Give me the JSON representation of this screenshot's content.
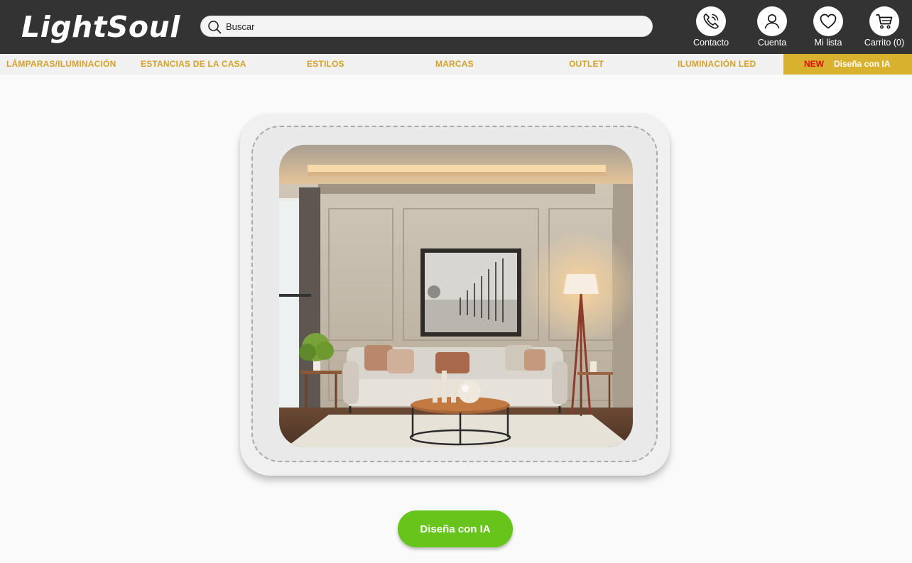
{
  "brand": {
    "logo_text": "LightSoul"
  },
  "search": {
    "placeholder": "Buscar"
  },
  "header_actions": {
    "contact": {
      "label": "Contacto",
      "icon": "phone-icon"
    },
    "account": {
      "label": "Cuenta",
      "icon": "user-icon"
    },
    "wishlist": {
      "label": "Mi lista",
      "icon": "heart-icon"
    },
    "cart": {
      "label": "Carrito (0)",
      "icon": "cart-icon"
    }
  },
  "nav": {
    "items": [
      {
        "label": "LÁMPARAS/ILUMINACIÓN"
      },
      {
        "label": "ESTANCIAS DE LA CASA"
      },
      {
        "label": "ESTILOS"
      },
      {
        "label": "MARCAS"
      },
      {
        "label": "OUTLET"
      },
      {
        "label": "ILUMINACIÓN LED"
      }
    ],
    "ai_item": {
      "badge": "NEW",
      "label": "Diseña con IA"
    }
  },
  "main": {
    "image_alt": "living-room-with-lamp",
    "cta_label": "Diseña con IA"
  },
  "colors": {
    "header_bg": "#333333",
    "nav_text": "#d6a12a",
    "nav_ai_bg": "#d8b12e",
    "new_badge": "#e00d0d",
    "cta_bg": "#66c41a"
  }
}
